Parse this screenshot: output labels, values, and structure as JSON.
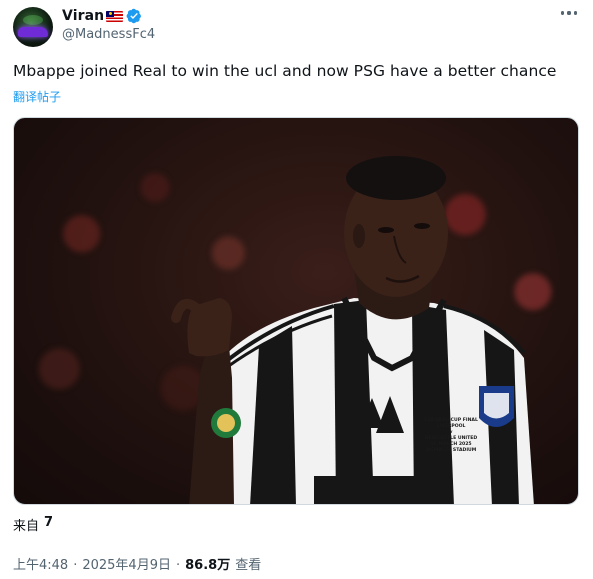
{
  "author": {
    "display_name": "Viran",
    "handle": "@MadnessFc4",
    "flag_icon": "malaysia-flag-icon",
    "verified_icon": "verified-badge-icon",
    "verified_color": "#1d9bf0"
  },
  "tweet": {
    "text": "Mbappe joined Real to win the ucl and now PSG have a better chance",
    "translate_label": "翻译帖子",
    "media_alt": "Football player in black-and-white striped kit pointing with thumb"
  },
  "media_overlay": {
    "match_text_1": "CARABAO CUP FINAL",
    "match_text_2": "LIVERPOOL",
    "match_text_3": "v",
    "match_text_4": "NEWCASTLE UNITED",
    "match_text_5": "16 MARCH 2025",
    "match_text_6": "WEMBLEY STADIUM"
  },
  "source": {
    "label": "来自",
    "value": "7"
  },
  "meta": {
    "time": "上午4:48",
    "date": "2025年4月9日",
    "separator": "·",
    "views_count": "86.8万",
    "views_label": "查看"
  },
  "colors": {
    "accent": "#1d9bf0",
    "secondary_text": "#536471",
    "primary_text": "#0f1419"
  }
}
